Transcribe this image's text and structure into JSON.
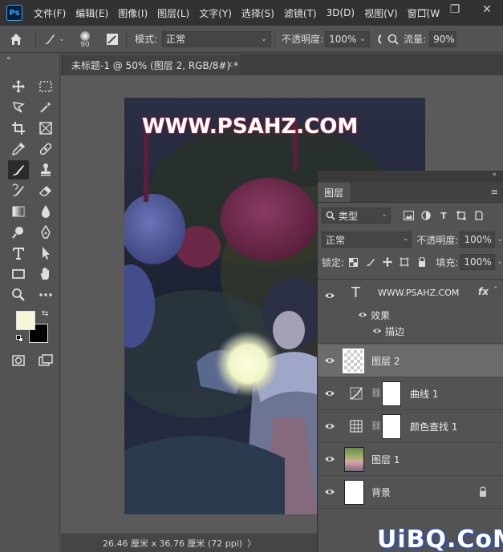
{
  "app": {
    "logo": "Ps",
    "menu": [
      "文件(F)",
      "编辑(E)",
      "图像(I)",
      "图层(L)",
      "文字(Y)",
      "选择(S)",
      "滤镜(T)",
      "3D(D)",
      "视图(V)",
      "窗口(W"
    ],
    "window_controls": [
      "—",
      "❐",
      "✕"
    ]
  },
  "options_bar": {
    "brush_size": "90",
    "mode_label": "模式:",
    "mode_value": "正常",
    "opacity_label": "不透明度:",
    "opacity_value": "100%",
    "flow_label": "流量:",
    "flow_value": "90%"
  },
  "document": {
    "tab_title": "未标题-1 @ 50% (图层 2, RGB/8#) *",
    "tab_close": "×",
    "canvas_text": "WWW.PSAHZ.COM",
    "status": "26.46 厘米 x 36.76 厘米 (72 ppi)",
    "status_caret": "〉"
  },
  "layers_panel": {
    "tab_label": "图层",
    "filter_type": "类型",
    "blend_mode": "正常",
    "opacity_label": "不透明度:",
    "opacity_value": "100%",
    "lock_label": "锁定:",
    "fill_label": "填充:",
    "fill_value": "100%",
    "collapse_glyph": "«",
    "menu_glyph": "≡",
    "layers": [
      {
        "name": "WWW.PSAHZ.COM",
        "kind": "text",
        "fx": "fx",
        "effects_label": "效果",
        "stroke_label": "描边"
      },
      {
        "name": "图层 2",
        "kind": "pixel",
        "selected": true
      },
      {
        "name": "曲线 1",
        "kind": "curves-adjustment"
      },
      {
        "name": "颜色查找 1",
        "kind": "color-lookup-adjustment"
      },
      {
        "name": "图层 1",
        "kind": "photo"
      },
      {
        "name": "背景",
        "kind": "background",
        "locked": true
      }
    ]
  },
  "watermark": "UiBQ.CoM",
  "colors": {
    "foreground": "#f4f7d8",
    "background": "#000000",
    "text_layer_fill": "#ffffff",
    "text_stroke": "#c81e3c"
  }
}
